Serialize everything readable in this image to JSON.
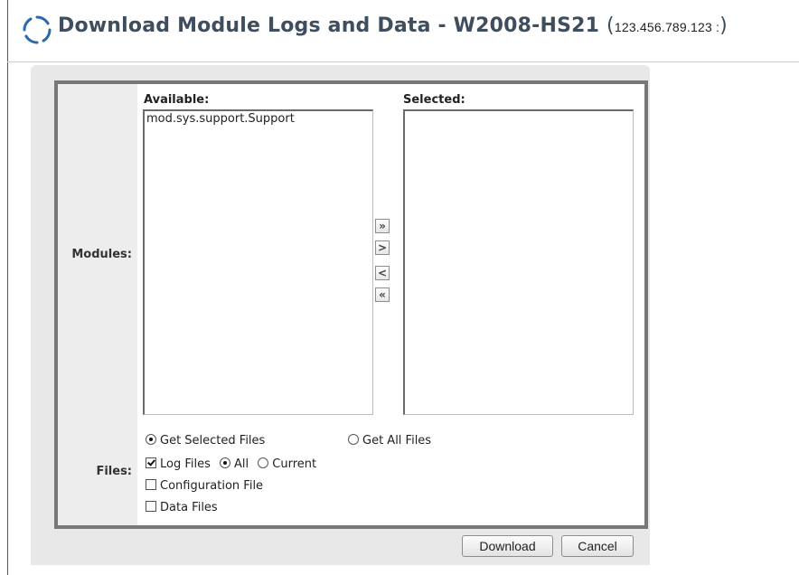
{
  "header": {
    "title": "Download Module Logs and Data - W2008-HS21",
    "open_paren": "(",
    "ip": "123.456.789.123",
    "ip_suffix": " :",
    "close_paren": ")"
  },
  "form": {
    "modules_label": "Modules:",
    "files_label": "Files:",
    "available_header": "Available:",
    "selected_header": "Selected:",
    "available_items": [
      "mod.sys.support.Support"
    ],
    "selected_items": [],
    "move_buttons": {
      "add_all": "»",
      "add": ">",
      "remove": "<",
      "remove_all": "«"
    },
    "get_selected_files": "Get Selected Files",
    "get_all_files": "Get All Files",
    "log_files": "Log Files",
    "log_all": "All",
    "log_current": "Current",
    "configuration_file": "Configuration File",
    "data_files": "Data Files"
  },
  "actions": {
    "download": "Download",
    "cancel": "Cancel"
  },
  "colors": {
    "title": "#3e4e5e",
    "spinner": "#2d6aa8",
    "frame": "#777777",
    "panel": "#e8e8e8"
  }
}
